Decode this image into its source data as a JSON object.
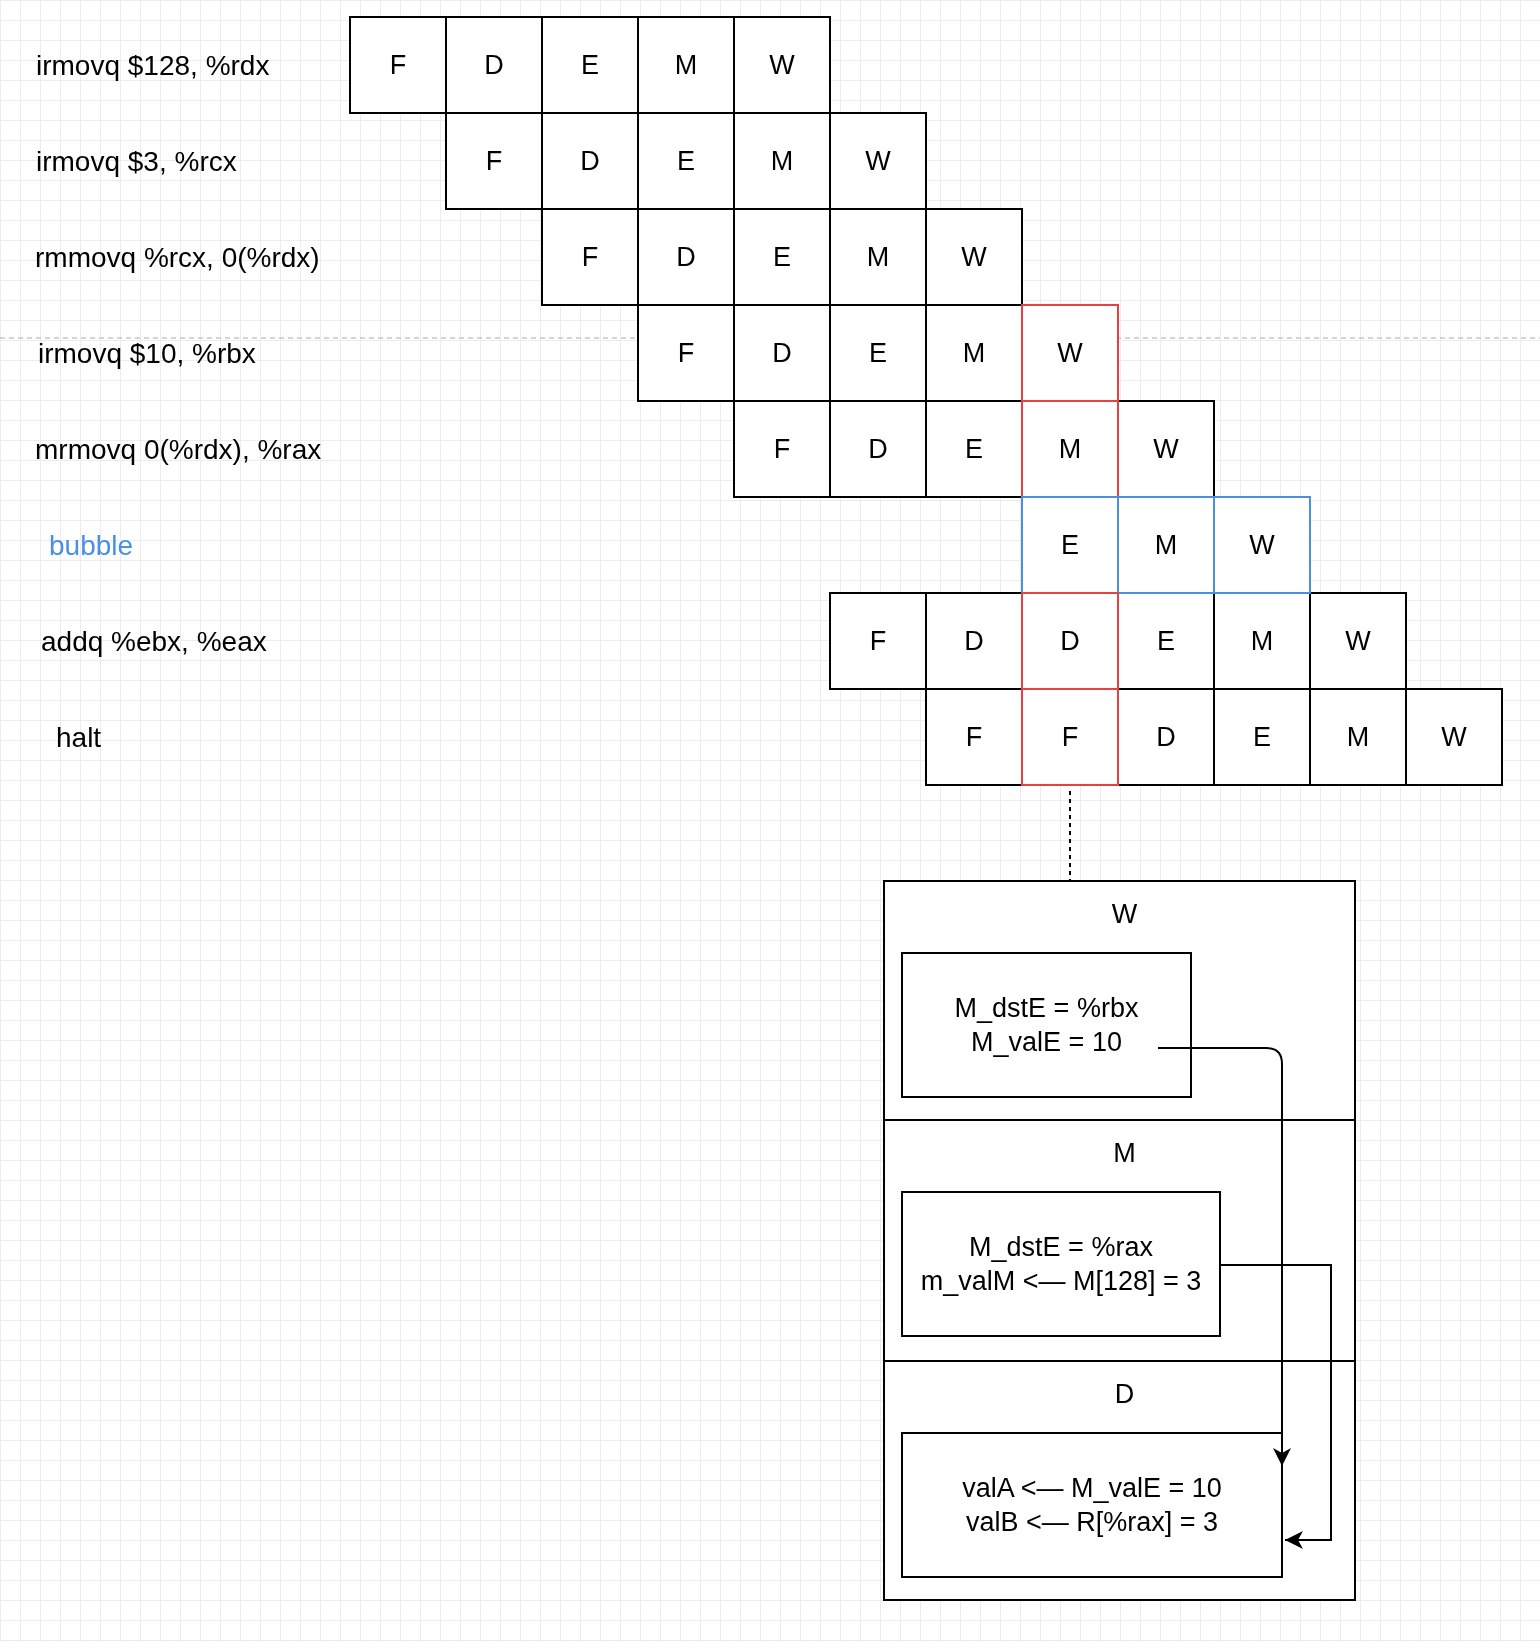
{
  "instructions": [
    {
      "label": "irmovq $128, %rdx",
      "stages": [
        {
          "text": "F"
        },
        {
          "text": "D"
        },
        {
          "text": "E"
        },
        {
          "text": "M"
        },
        {
          "text": "W"
        }
      ]
    },
    {
      "label": "irmovq $3, %rcx",
      "stages": [
        {
          "text": "F"
        },
        {
          "text": "D"
        },
        {
          "text": "E"
        },
        {
          "text": "M"
        },
        {
          "text": "W"
        }
      ]
    },
    {
      "label": "rmmovq %rcx, 0(%rdx)",
      "stages": [
        {
          "text": "F"
        },
        {
          "text": "D"
        },
        {
          "text": "E"
        },
        {
          "text": "M"
        },
        {
          "text": "W"
        }
      ]
    },
    {
      "label": "irmovq $10, %rbx",
      "stages": [
        {
          "text": "F"
        },
        {
          "text": "D"
        },
        {
          "text": "E"
        },
        {
          "text": "M"
        },
        {
          "text": "W",
          "color": "#e84040"
        }
      ]
    },
    {
      "label": "mrmovq 0(%rdx), %rax",
      "stages": [
        {
          "text": "F"
        },
        {
          "text": "D"
        },
        {
          "text": "E"
        },
        {
          "text": "M",
          "color": "#e84040"
        },
        {
          "text": "W"
        }
      ]
    },
    {
      "label": "bubble",
      "color": "#4a90e2",
      "stages": [
        {
          "text": "E",
          "color": "#4a90e2"
        },
        {
          "text": "M",
          "color": "#4a90e2"
        },
        {
          "text": "W",
          "color": "#4a90e2"
        }
      ]
    },
    {
      "label": "addq %ebx, %eax",
      "stages": [
        {
          "text": "F"
        },
        {
          "text": "D"
        },
        {
          "text": "D",
          "color": "#e84040"
        },
        {
          "text": "E"
        },
        {
          "text": "M"
        },
        {
          "text": "W"
        }
      ]
    },
    {
      "label": "halt",
      "stages": [
        {
          "text": "F"
        },
        {
          "text": "F",
          "color": "#e84040"
        },
        {
          "text": "D"
        },
        {
          "text": "E"
        },
        {
          "text": "M"
        },
        {
          "text": "W"
        }
      ]
    }
  ],
  "detail": {
    "sections": [
      {
        "stage": "W",
        "lines": [
          "M_dstE = %rbx",
          "M_valE = 10"
        ]
      },
      {
        "stage": "M",
        "lines": [
          "M_dstE = %rax",
          "m_valM <— M[128] = 3"
        ]
      },
      {
        "stage": "D",
        "lines": [
          "valA <— M_valE = 10",
          "valB <— R[%rax] = 3"
        ]
      }
    ]
  }
}
